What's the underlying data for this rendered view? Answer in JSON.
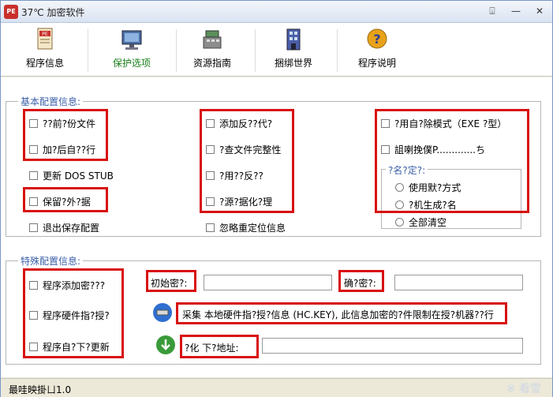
{
  "window": {
    "title": "37℃ 加密软件",
    "app_icon_text": "PE"
  },
  "toolbar": {
    "items": [
      {
        "label": "程序信息",
        "icon": "pe-document-icon",
        "active": false
      },
      {
        "label": "保护选项",
        "icon": "monitor-shield-icon",
        "active": true
      },
      {
        "label": "资源指南",
        "icon": "cash-register-icon",
        "active": false
      },
      {
        "label": "捆绑世界",
        "icon": "building-icon",
        "active": false
      },
      {
        "label": "程序说明",
        "icon": "help-question-icon",
        "active": false
      }
    ]
  },
  "basic_group": {
    "legend": "基本配置信息:",
    "col1": [
      "??前?份文件",
      "加?后自??行",
      "更新 DOS STUB",
      "保留?外?据",
      "退出保存配置"
    ],
    "col2": [
      "添加反??代?",
      "?查文件完整性",
      "?用??反??",
      "?源?据化?理",
      "忽略重定位信息"
    ],
    "col3": [
      "?用自?除模式（EXE ?型）",
      "詛喇挽僕P.............ち"
    ],
    "name_group": {
      "legend": "?名?定?:",
      "options": [
        "使用默?方式",
        "?机生成?名",
        "全部清空"
      ]
    }
  },
  "special_group": {
    "legend": "特殊配置信息:",
    "checks": [
      "程序添加密???",
      "程序硬件指?授?",
      "程序自?下?更新"
    ],
    "initial_password_label": "初始密?:",
    "confirm_password_label": "确?密?:",
    "collect_text": "采集  本地硬件指?授?信息 (HC.KEY), 此信息加密的?件限制在授?机器??行",
    "download_label": "?化   下?地址:"
  },
  "status": {
    "text": "最哇映掛ㄩ1.0",
    "watermark": "※ 看雪"
  },
  "colors": {
    "highlight": "#d81010",
    "legend": "#3a5fa8",
    "active_tab": "#1a7f1a"
  }
}
